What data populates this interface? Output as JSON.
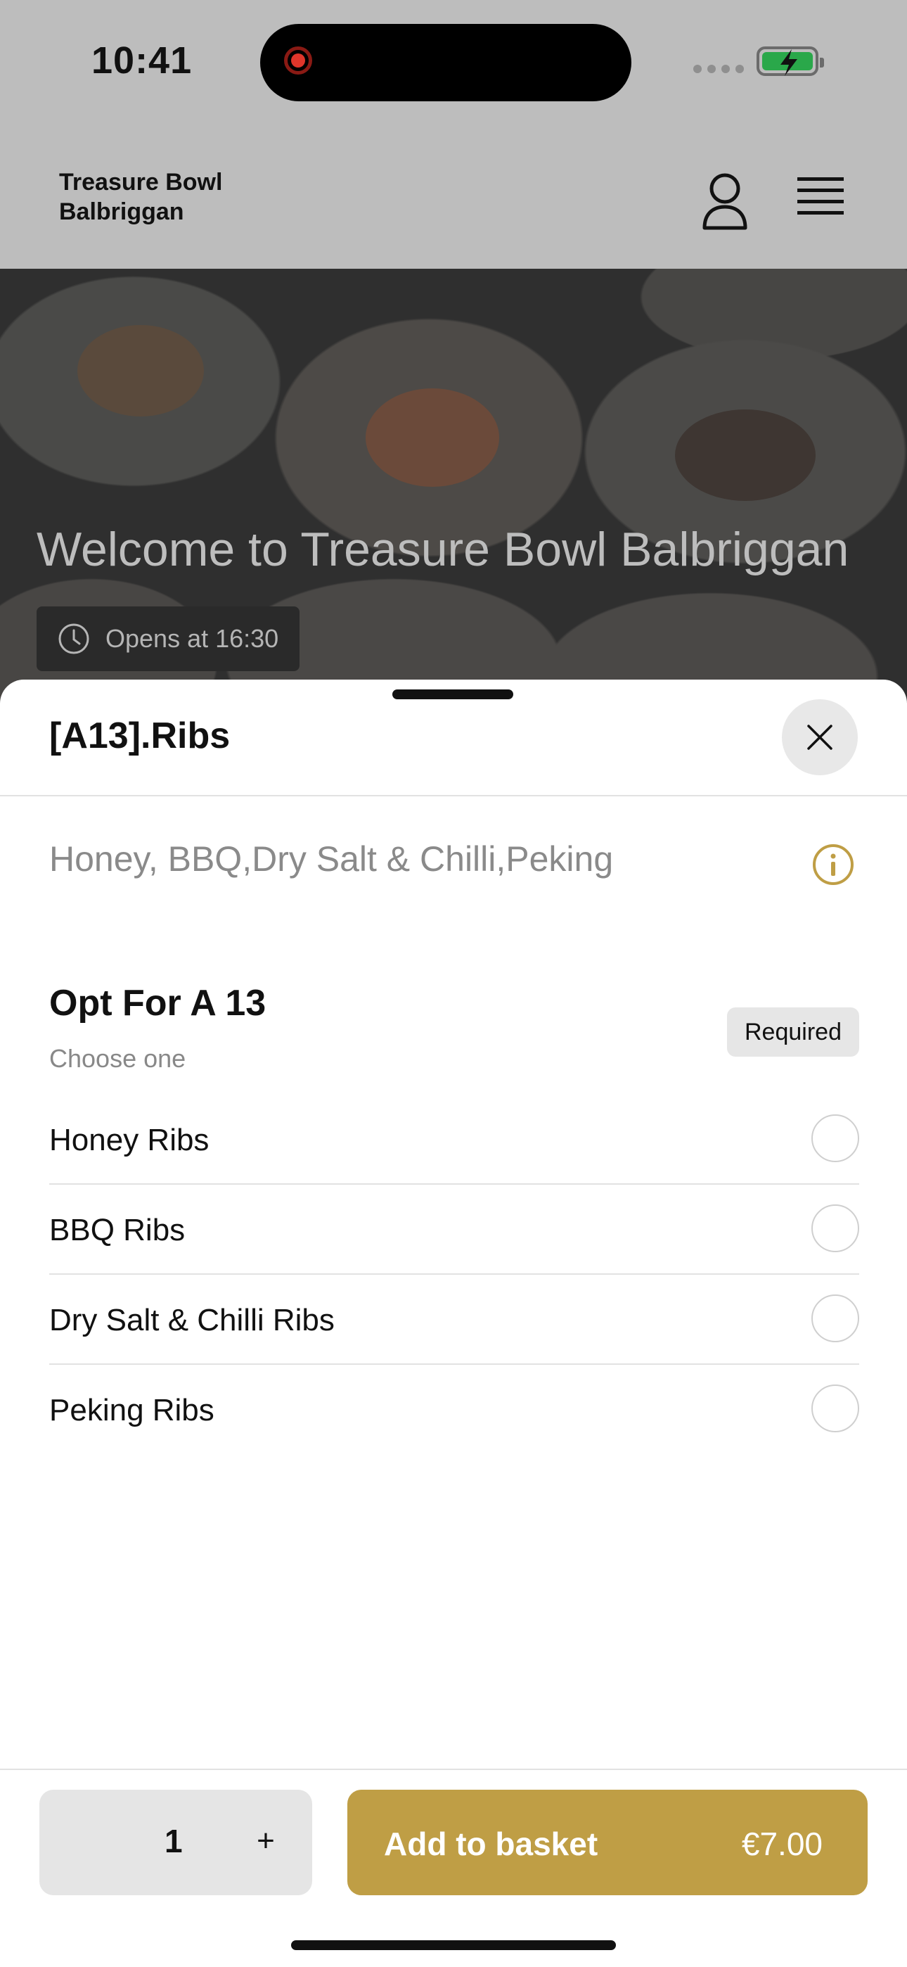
{
  "status_bar": {
    "time": "10:41"
  },
  "header": {
    "brand_line1": "Treasure Bowl",
    "brand_line2": "Balbriggan"
  },
  "hero": {
    "title": "Welcome to Treasure Bowl Balbriggan",
    "hours": "Opens at 16:30"
  },
  "sheet": {
    "title": "[A13].Ribs",
    "description": "Honey, BBQ,Dry Salt & Chilli,Peking",
    "group": {
      "title": "Opt For A 13",
      "subtitle": "Choose one",
      "badge": "Required",
      "options": [
        {
          "label": "Honey Ribs"
        },
        {
          "label": "BBQ Ribs"
        },
        {
          "label": "Dry Salt & Chilli Ribs"
        },
        {
          "label": "Peking Ribs"
        }
      ]
    }
  },
  "footer": {
    "quantity": "1",
    "plus_label": "+",
    "add_label": "Add to basket",
    "price": "€7.00"
  },
  "colors": {
    "accent": "#bf9e45",
    "overlay": "#bdbdbd",
    "badge_bg": "#e6e6e6"
  },
  "icons": [
    "record-icon",
    "signal-icon",
    "battery-icon",
    "user-icon",
    "menu-icon",
    "clock-icon",
    "close-icon",
    "info-icon"
  ]
}
